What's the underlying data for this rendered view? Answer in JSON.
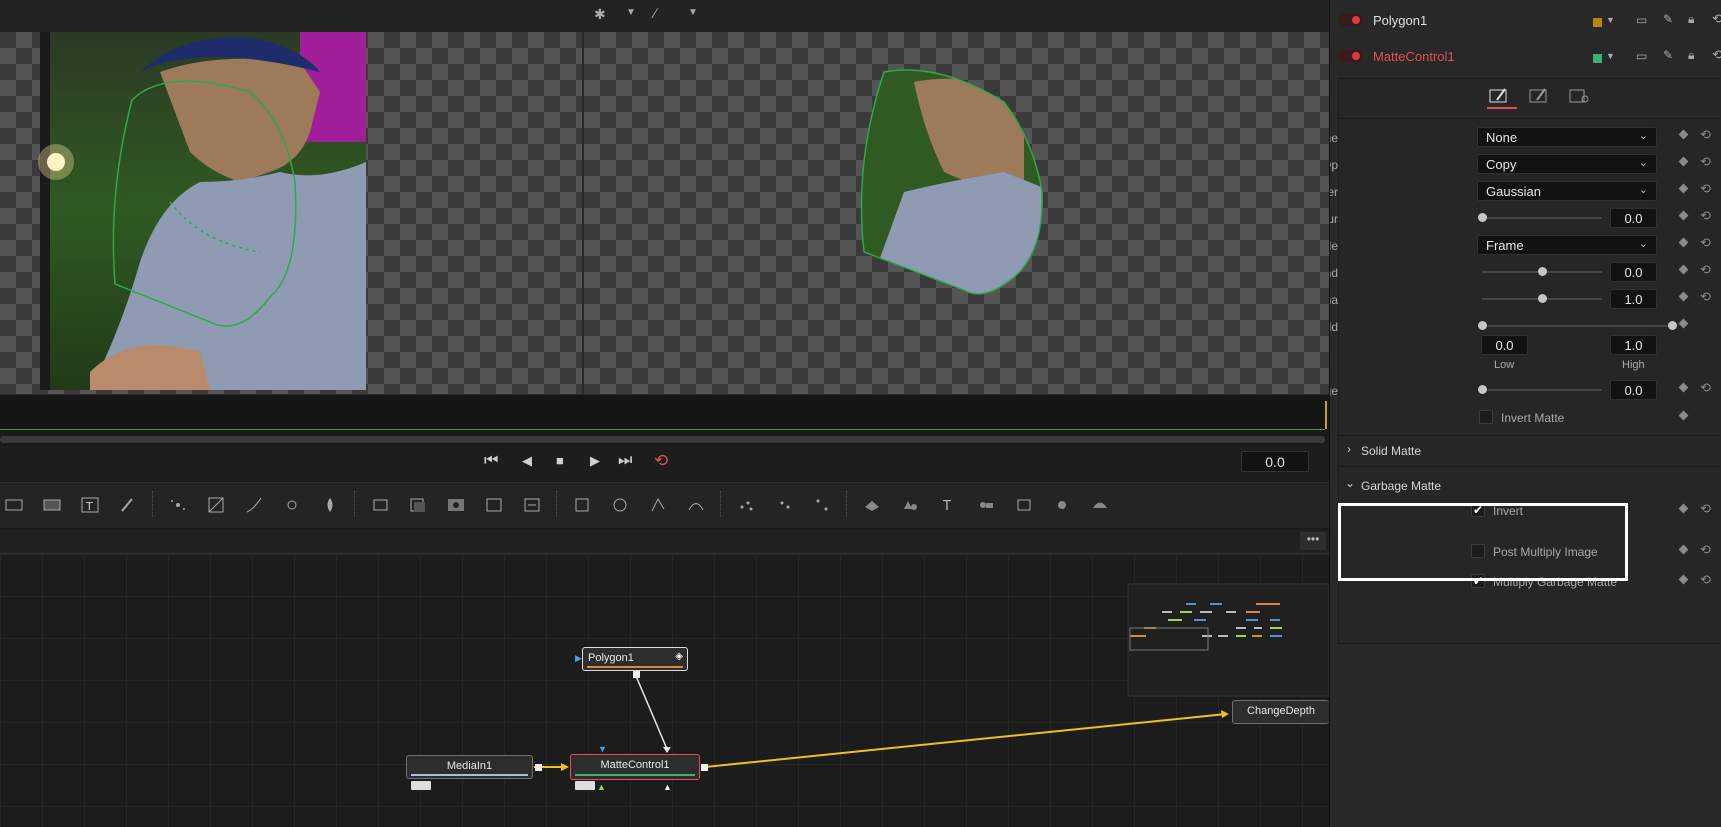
{
  "viewer_toolbar": {
    "icons": [
      "bug-icon",
      "chevron-down-icon",
      "magic-wand-icon",
      "chevron-down-icon"
    ]
  },
  "transport": {
    "frame_value": "0.0"
  },
  "inspector": {
    "tools": [
      {
        "name": "Polygon1",
        "swatch": "#b8860b",
        "label_color": "#e0e0e0"
      },
      {
        "name": "MatteControl1",
        "swatch": "#3cb371",
        "label_color": "#e05050"
      }
    ],
    "tabs": [
      "controls-tab",
      "modifiers-tab",
      "settings-tab"
    ],
    "rows": {
      "matte_combine": {
        "label": "Matte Combine",
        "value": "None"
      },
      "combine_op": {
        "label": "Combine Op",
        "value": "Copy"
      },
      "filter": {
        "label": "Filter",
        "value": "Gaussian"
      },
      "matte_blur": {
        "label": "Matte Blur",
        "value": "0.0",
        "level": 0
      },
      "clipping_mode": {
        "label": "Clipping Mode",
        "value": "Frame"
      },
      "contract_expand": {
        "label": "e Contract / Expand",
        "value": "0.0",
        "level": 0.5
      },
      "matte_gamma": {
        "label": "Matte Gamma",
        "value": "1.0",
        "level": 0.5
      },
      "matte_threshold": {
        "label": "Matte Threshold",
        "low": "0.0",
        "high": "1.0",
        "low_label": "Low",
        "high_label": "High"
      },
      "restore_fringe": {
        "label": "Restore Fringe",
        "value": "0.0",
        "level": 0
      },
      "invert_matte": {
        "label": "Invert Matte",
        "checked": false
      }
    },
    "sections": {
      "solid_matte": "Solid Matte",
      "garbage_matte": "Garbage Matte"
    },
    "garbage": {
      "invert": {
        "label": "Invert",
        "checked": true
      },
      "post_multiply": {
        "label": "Post Multiply Image",
        "checked": false
      },
      "multiply_garbage": {
        "label": "Multiply Garbage Matte",
        "checked": true
      }
    }
  },
  "nodes": {
    "polygon": "Polygon1",
    "mediain": "MediaIn1",
    "mattecontrol": "MatteControl1",
    "changedepth": "ChangeDepth"
  },
  "colors": {
    "accent_red": "#e05050",
    "link_yellow": "#f0c020",
    "highlight_box": "#ffffff"
  }
}
